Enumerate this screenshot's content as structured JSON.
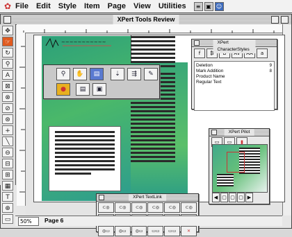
{
  "menubar": {
    "items": [
      "File",
      "Edit",
      "Style",
      "Item",
      "Page",
      "View",
      "Utilities"
    ]
  },
  "window": {
    "title": "XPert Tools Review"
  },
  "palettes": {
    "character_styles": {
      "title": "XPert CharacterStyles",
      "styles": [
        "Deletion",
        "Mark Addition",
        "Product Name",
        "Regular Text"
      ],
      "shortcuts": [
        "9",
        "8"
      ]
    },
    "pilot": {
      "title": "XPert Pilot"
    },
    "textlink": {
      "title": "XPert TextLink"
    }
  },
  "statusbar": {
    "zoom": "50%",
    "page": "Page 6"
  },
  "colors": {
    "selected_tool": "#e05a1f",
    "page_green": "#3aa878"
  }
}
